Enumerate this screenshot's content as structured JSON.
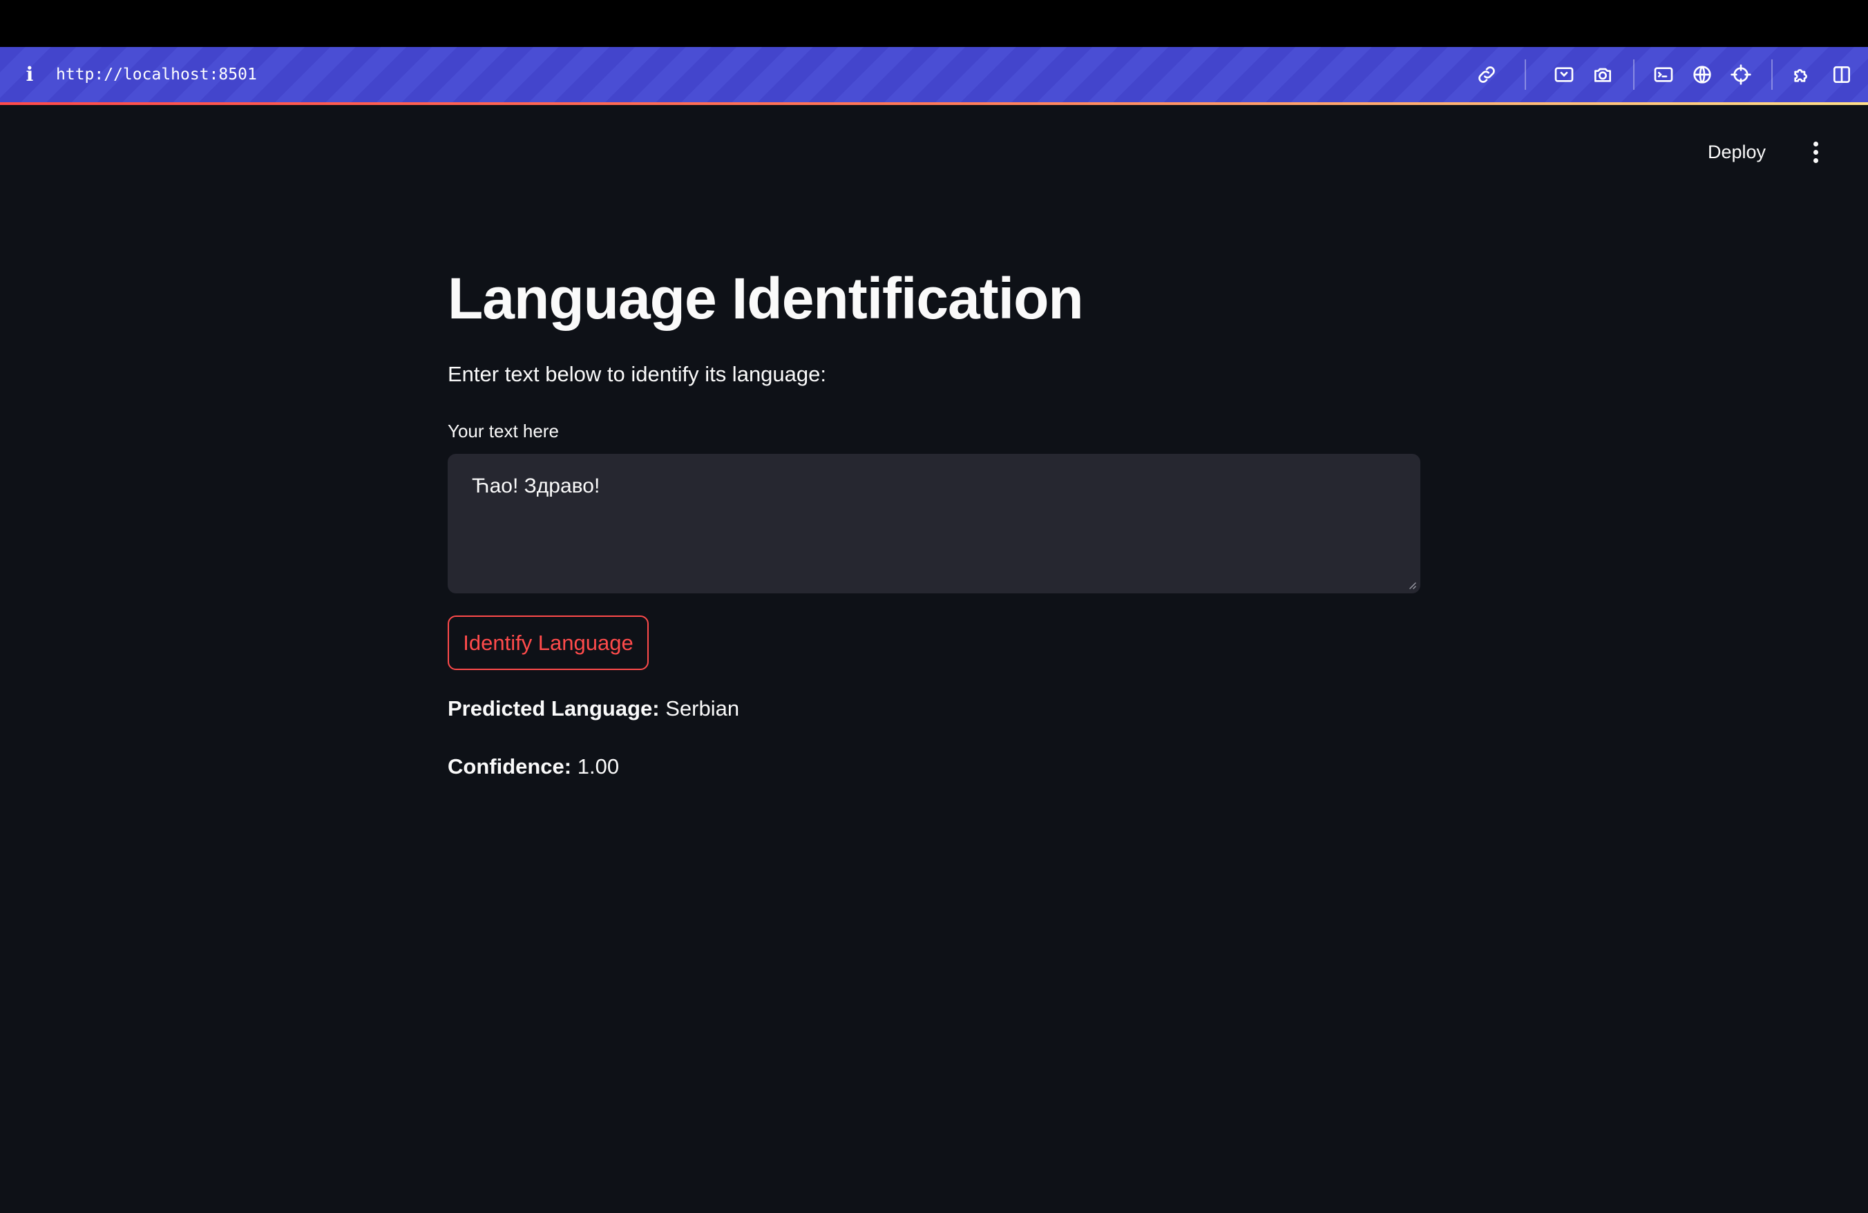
{
  "browser": {
    "url": "http://localhost:8501",
    "toolbar_icons": [
      "link-icon",
      "screenshot-area-icon",
      "camera-icon",
      "terminal-icon",
      "globe-icon",
      "crosshair-icon",
      "extensions-icon",
      "split-view-icon"
    ]
  },
  "header": {
    "deploy_label": "Deploy",
    "menu_icon": "kebab-menu-icon"
  },
  "main": {
    "title": "Language Identification",
    "subtitle": "Enter text below to identify its language:",
    "input_label": "Your text here",
    "input_value": "Ћао! Здраво!",
    "button_label": "Identify Language",
    "prediction_label": "Predicted Language:",
    "prediction_value": "Serbian",
    "confidence_label": "Confidence:",
    "confidence_value": "1.00"
  },
  "colors": {
    "background": "#0e1117",
    "browser_bar": "#4345cc",
    "accent": "#ff4b4b",
    "input_bg": "#262730"
  }
}
